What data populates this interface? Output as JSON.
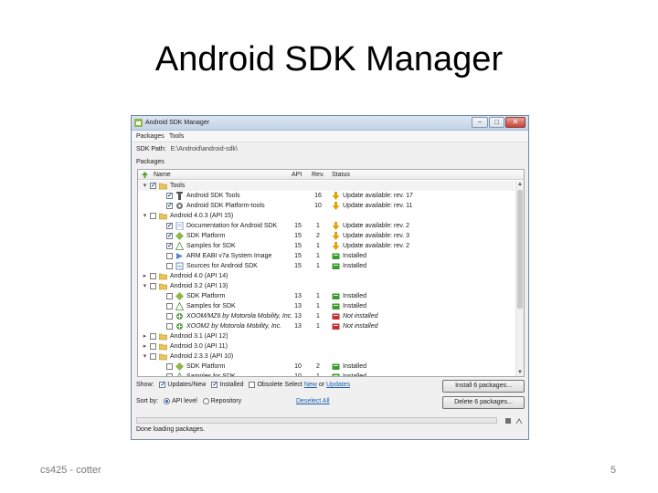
{
  "slide": {
    "title": "Android SDK Manager",
    "footer_left": "cs425 - cotter",
    "page_number": "5"
  },
  "window": {
    "title": "Android SDK Manager",
    "min_glyph": "–",
    "max_glyph": "□",
    "close_glyph": "✕"
  },
  "menu": {
    "packages": "Packages",
    "tools": "Tools"
  },
  "sdk_path": {
    "label": "SDK Path:",
    "value": "E:\\Android\\android-sdk\\"
  },
  "packages_label": "Packages",
  "table": {
    "headers": {
      "name": "Name",
      "api": "API",
      "rev": "Rev.",
      "status": "Status"
    },
    "rows": [
      {
        "level": 0,
        "expander": "▾",
        "checked": true,
        "icon": "folder-icon",
        "name": "Tools",
        "api": "",
        "rev": "",
        "status_icon": "",
        "status": ""
      },
      {
        "level": 1,
        "expander": "",
        "checked": true,
        "icon": "tools-icon",
        "name": "Android SDK Tools",
        "api": "",
        "rev": "16",
        "status_icon": "update-arrow-icon",
        "status": "Update available: rev. 17"
      },
      {
        "level": 1,
        "expander": "",
        "checked": true,
        "icon": "platform-tools-icon",
        "name": "Android SDK Platform-tools",
        "api": "",
        "rev": "10",
        "status_icon": "update-arrow-icon",
        "status": "Update available: rev. 11"
      },
      {
        "level": 0,
        "expander": "▾",
        "checked": false,
        "icon": "folder-icon",
        "name": "Android 4.0.3 (API 15)",
        "api": "",
        "rev": "",
        "status_icon": "",
        "status": ""
      },
      {
        "level": 1,
        "expander": "",
        "checked": true,
        "icon": "doc-icon",
        "name": "Documentation for Android SDK",
        "api": "15",
        "rev": "1",
        "status_icon": "update-arrow-icon",
        "status": "Update available: rev. 2"
      },
      {
        "level": 1,
        "expander": "",
        "checked": true,
        "icon": "platform-icon",
        "name": "SDK Platform",
        "api": "15",
        "rev": "2",
        "status_icon": "update-arrow-icon",
        "status": "Update available: rev. 3"
      },
      {
        "level": 1,
        "expander": "",
        "checked": true,
        "icon": "samples-icon",
        "name": "Samples for SDK",
        "api": "15",
        "rev": "1",
        "status_icon": "update-arrow-icon",
        "status": "Update available: rev. 2"
      },
      {
        "level": 1,
        "expander": "",
        "checked": false,
        "icon": "system-image-icon",
        "name": "ARM EABI v7a System Image",
        "api": "15",
        "rev": "1",
        "status_icon": "installed-icon",
        "status": "Installed"
      },
      {
        "level": 1,
        "expander": "",
        "checked": false,
        "icon": "sources-icon",
        "name": "Sources for Android SDK",
        "api": "15",
        "rev": "1",
        "status_icon": "installed-icon",
        "status": "Installed"
      },
      {
        "level": 0,
        "expander": "▸",
        "checked": false,
        "icon": "folder-icon",
        "name": "Android 4.0 (API 14)",
        "api": "",
        "rev": "",
        "status_icon": "",
        "status": ""
      },
      {
        "level": 0,
        "expander": "▾",
        "checked": false,
        "icon": "folder-icon",
        "name": "Android 3.2 (API 13)",
        "api": "",
        "rev": "",
        "status_icon": "",
        "status": ""
      },
      {
        "level": 1,
        "expander": "",
        "checked": false,
        "icon": "platform-icon",
        "name": "SDK Platform",
        "api": "13",
        "rev": "1",
        "status_icon": "installed-icon",
        "status": "Installed"
      },
      {
        "level": 1,
        "expander": "",
        "checked": false,
        "icon": "samples-icon",
        "name": "Samples for SDK",
        "api": "13",
        "rev": "1",
        "status_icon": "installed-icon",
        "status": "Installed"
      },
      {
        "level": 1,
        "expander": "",
        "checked": false,
        "icon": "addon-icon",
        "name": "XOOM/MZ6 by Motorola Mobility, Inc.",
        "italic": true,
        "api": "13",
        "rev": "1",
        "status_icon": "not-installed-icon",
        "status": "Not installed"
      },
      {
        "level": 1,
        "expander": "",
        "checked": false,
        "icon": "addon-icon",
        "name": "XOOM2 by Motorola Mobility, Inc.",
        "italic": true,
        "api": "13",
        "rev": "1",
        "status_icon": "not-installed-icon",
        "status": "Not installed"
      },
      {
        "level": 0,
        "expander": "▸",
        "checked": false,
        "icon": "folder-icon",
        "name": "Android 3.1 (API 12)",
        "api": "",
        "rev": "",
        "status_icon": "",
        "status": ""
      },
      {
        "level": 0,
        "expander": "▸",
        "checked": false,
        "icon": "folder-icon",
        "name": "Android 3.0 (API 11)",
        "api": "",
        "rev": "",
        "status_icon": "",
        "status": ""
      },
      {
        "level": 0,
        "expander": "▾",
        "checked": false,
        "icon": "folder-icon",
        "name": "Android 2.3.3 (API 10)",
        "api": "",
        "rev": "",
        "status_icon": "",
        "status": ""
      },
      {
        "level": 1,
        "expander": "",
        "checked": false,
        "icon": "platform-icon",
        "name": "SDK Platform",
        "api": "10",
        "rev": "2",
        "status_icon": "installed-icon",
        "status": "Installed"
      },
      {
        "level": 1,
        "expander": "",
        "checked": false,
        "icon": "samples-icon",
        "name": "Samples for SDK",
        "api": "10",
        "rev": "1",
        "status_icon": "installed-icon",
        "status": "Installed"
      }
    ]
  },
  "show": {
    "label": "Show:",
    "updates_new": "Updates/New",
    "updates_new_checked": true,
    "installed": "Installed",
    "installed_checked": true,
    "obsolete": "Obsolete",
    "obsolete_checked": false,
    "select_label": "Select",
    "new_link": "New",
    "or": "or",
    "updates_link": "Updates"
  },
  "sort": {
    "label": "Sort by:",
    "api_level": "API level",
    "api_level_selected": true,
    "repository": "Repository",
    "deselect_all": "Deselect All"
  },
  "buttons": {
    "install": "Install 6 packages...",
    "delete": "Delete 6 packages..."
  },
  "status_bar": {
    "text": "Done loading packages."
  },
  "colors": {
    "update_arrow": "#e0a30a",
    "installed_green": "#3b9b2e",
    "not_installed_red": "#c62f2f",
    "folder_yellow": "#e8c45a",
    "link_blue": "#1c5fb0"
  }
}
